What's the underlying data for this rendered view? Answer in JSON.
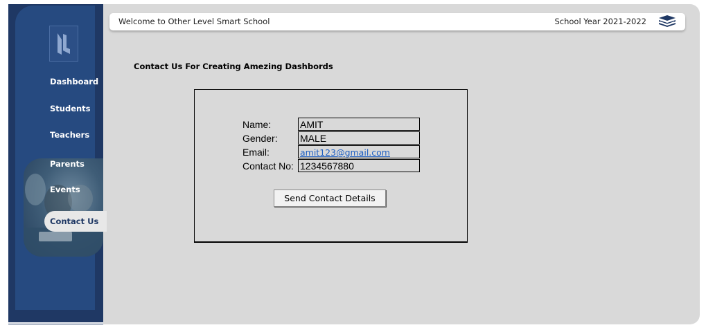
{
  "header": {
    "welcome": "Welcome to Other Level Smart School",
    "school_year": "School Year 2021-2022",
    "books_icon": "books-icon"
  },
  "sidebar": {
    "logo_icon": "school-logo-icon",
    "items": [
      {
        "label": "Dashboard",
        "active": false
      },
      {
        "label": "Students",
        "active": false
      },
      {
        "label": "Teachers",
        "active": false
      },
      {
        "label": "Parents",
        "active": false
      },
      {
        "label": "Events",
        "active": false
      },
      {
        "label": "Contact Us",
        "active": true
      }
    ]
  },
  "main": {
    "title": "Contact Us For Creating Amezing Dashbords",
    "form": {
      "fields": [
        {
          "label": "Name:",
          "value": "AMIT"
        },
        {
          "label": "Gender:",
          "value": "MALE"
        },
        {
          "label": "Email:",
          "value": "amit123@gmail.com"
        },
        {
          "label": "Contact No:",
          "value": "1234567880"
        }
      ],
      "send_button": "Send Contact Details"
    }
  },
  "colors": {
    "sidebar": "#1f3864",
    "sidebar_inner": "#264a80",
    "content_bg": "#d9d9d9",
    "active_text": "#1f3864",
    "link": "#1f5fc2"
  }
}
